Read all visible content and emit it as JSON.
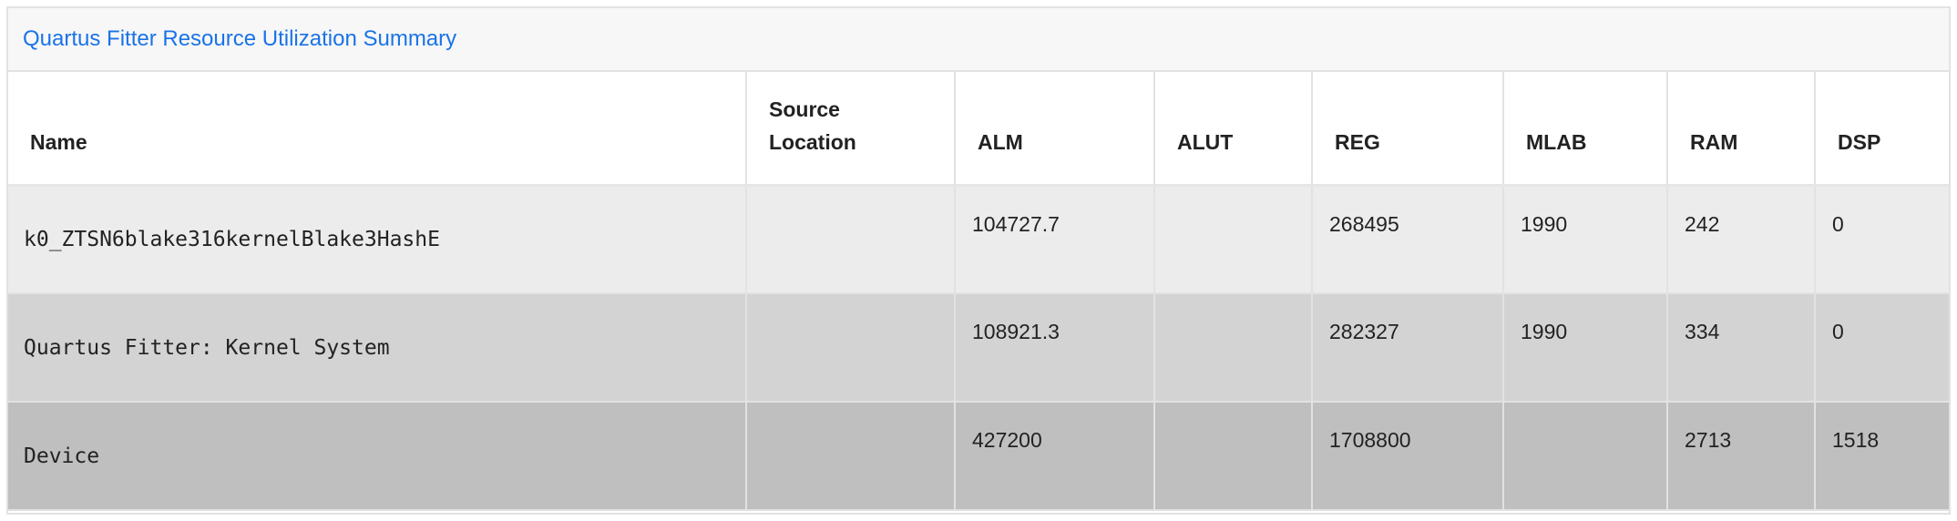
{
  "panel": {
    "title": "Quartus Fitter Resource Utilization Summary"
  },
  "table": {
    "headers": {
      "name": "Name",
      "source_location": "Source Location",
      "alm": "ALM",
      "alut": "ALUT",
      "reg": "REG",
      "mlab": "MLAB",
      "ram": "RAM",
      "dsp": "DSP"
    },
    "rows": [
      {
        "name": "k0_ZTSN6blake316kernelBlake3HashE",
        "source_location": "",
        "alm": "104727.7",
        "alut": "",
        "reg": "268495",
        "mlab": "1990",
        "ram": "242",
        "dsp": "0"
      },
      {
        "name": "Quartus Fitter: Kernel System",
        "source_location": "",
        "alm": "108921.3",
        "alut": "",
        "reg": "282327",
        "mlab": "1990",
        "ram": "334",
        "dsp": "0"
      },
      {
        "name": "Device",
        "source_location": "",
        "alm": "427200",
        "alut": "",
        "reg": "1708800",
        "mlab": "",
        "ram": "2713",
        "dsp": "1518"
      }
    ]
  },
  "colors": {
    "title_link": "#1a73e8",
    "row_0_bg": "#ececec",
    "row_1_bg": "#d3d3d3",
    "row_2_bg": "#bfbfbf",
    "border": "#e2e2e2"
  }
}
